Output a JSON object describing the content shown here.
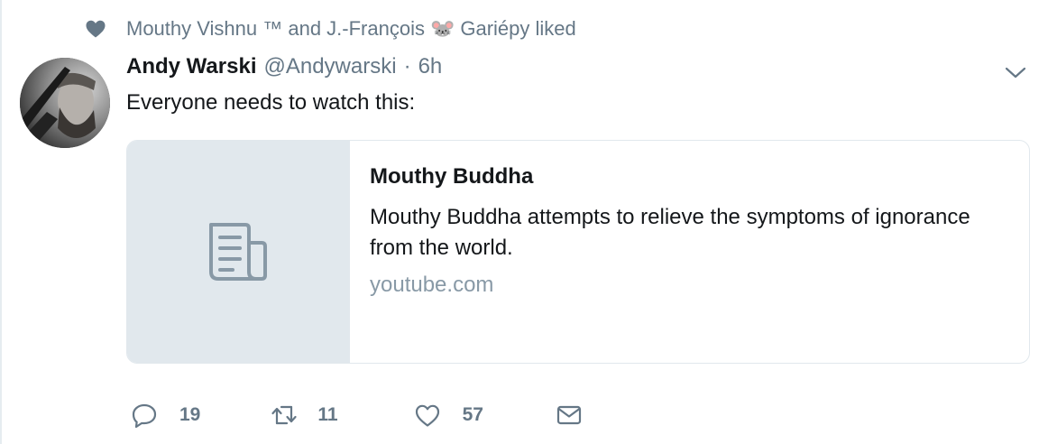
{
  "social_context": {
    "text_before": "Mouthy Vishnu ™ and J.-François",
    "emoji": "🐭",
    "text_after": "Gariépy liked",
    "icon": "heart-icon"
  },
  "tweet": {
    "author_name": "Andy Warski",
    "author_handle": "@Andywarski",
    "separator": "·",
    "timestamp": "6h",
    "text": "Everyone needs to watch this:",
    "menu_icon": "chevron-down-icon"
  },
  "card": {
    "title": "Mouthy Buddha",
    "description": "Mouthy Buddha attempts to relieve the symptoms of ignorance from the world.",
    "domain": "youtube.com",
    "thumbnail_icon": "document-icon"
  },
  "actions": {
    "reply_count": "19",
    "retweet_count": "11",
    "like_count": "57"
  },
  "colors": {
    "secondary_text": "#657786",
    "card_border": "#e1e8ed",
    "placeholder_bg": "#e1e8ed",
    "domain_text": "#8899a6"
  }
}
